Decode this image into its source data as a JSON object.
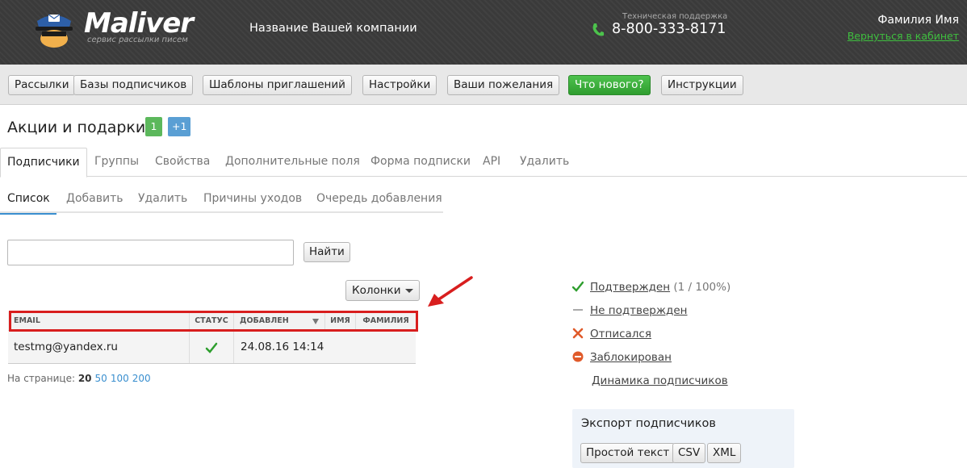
{
  "header": {
    "logo_text": "Maliver",
    "logo_tagline": "сервис рассылки писем",
    "company_name": "Название Вашей компании",
    "support_label": "Техническая поддержка",
    "phone": "8-800-333-8171",
    "user_name": "Фамилия Имя",
    "back_link": "Вернуться в кабинет"
  },
  "nav": {
    "items": [
      {
        "label": "Рассылки"
      },
      {
        "label": "Базы подписчиков"
      },
      {
        "label": "Шаблоны приглашений"
      },
      {
        "label": "Настройки"
      },
      {
        "label": "Ваши пожелания"
      },
      {
        "label": "Что нового?",
        "highlight": true
      },
      {
        "label": "Инструкции"
      }
    ]
  },
  "page": {
    "title": "Акции и подарки",
    "badge_count": "1",
    "badge_plus": "+1"
  },
  "main_tabs": [
    {
      "label": "Подписчики",
      "active": true
    },
    {
      "label": "Группы"
    },
    {
      "label": "Свойства"
    },
    {
      "label": "Дополнительные поля"
    },
    {
      "label": "Форма подписки"
    },
    {
      "label": "API"
    },
    {
      "label": "Удалить"
    }
  ],
  "sub_tabs": [
    {
      "label": "Список",
      "active": true
    },
    {
      "label": "Добавить"
    },
    {
      "label": "Удалить"
    },
    {
      "label": "Причины уходов"
    },
    {
      "label": "Очередь добавления"
    }
  ],
  "search": {
    "value": "",
    "button": "Найти"
  },
  "columns_button": "Колонки",
  "table": {
    "headers": [
      "Email",
      "Статус",
      "Добавлен",
      "Имя",
      "Фамилия"
    ],
    "rows": [
      {
        "email": "testmg@yandex.ru",
        "status": "confirmed",
        "added": "24.08.16 14:14",
        "name": "",
        "surname": ""
      }
    ]
  },
  "per_page": {
    "label": "На странице:",
    "current": "20",
    "options": [
      "50",
      "100",
      "200"
    ]
  },
  "legend": [
    {
      "label": "Подтвержден",
      "extra": "(1 / 100%)",
      "icon": "check-icon",
      "color": "#2e9e2e"
    },
    {
      "label": "Не подтвержден",
      "extra": "",
      "icon": "dash-icon",
      "color": "#aaaaaa"
    },
    {
      "label": "Отписался",
      "extra": "",
      "icon": "cross-icon",
      "color": "#e05a2a"
    },
    {
      "label": "Заблокирован",
      "extra": "",
      "icon": "blocked-icon",
      "color": "#e05a2a"
    },
    {
      "label": "Динамика подписчиков",
      "extra": "",
      "icon": "",
      "color": ""
    }
  ],
  "export": {
    "title": "Экспорт подписчиков",
    "buttons": [
      "Простой текст",
      "CSV",
      "XML"
    ]
  },
  "colors": {
    "accent_green": "#3fbf3f",
    "highlight_red": "#d81e1e",
    "link_blue": "#3a8fcf"
  }
}
